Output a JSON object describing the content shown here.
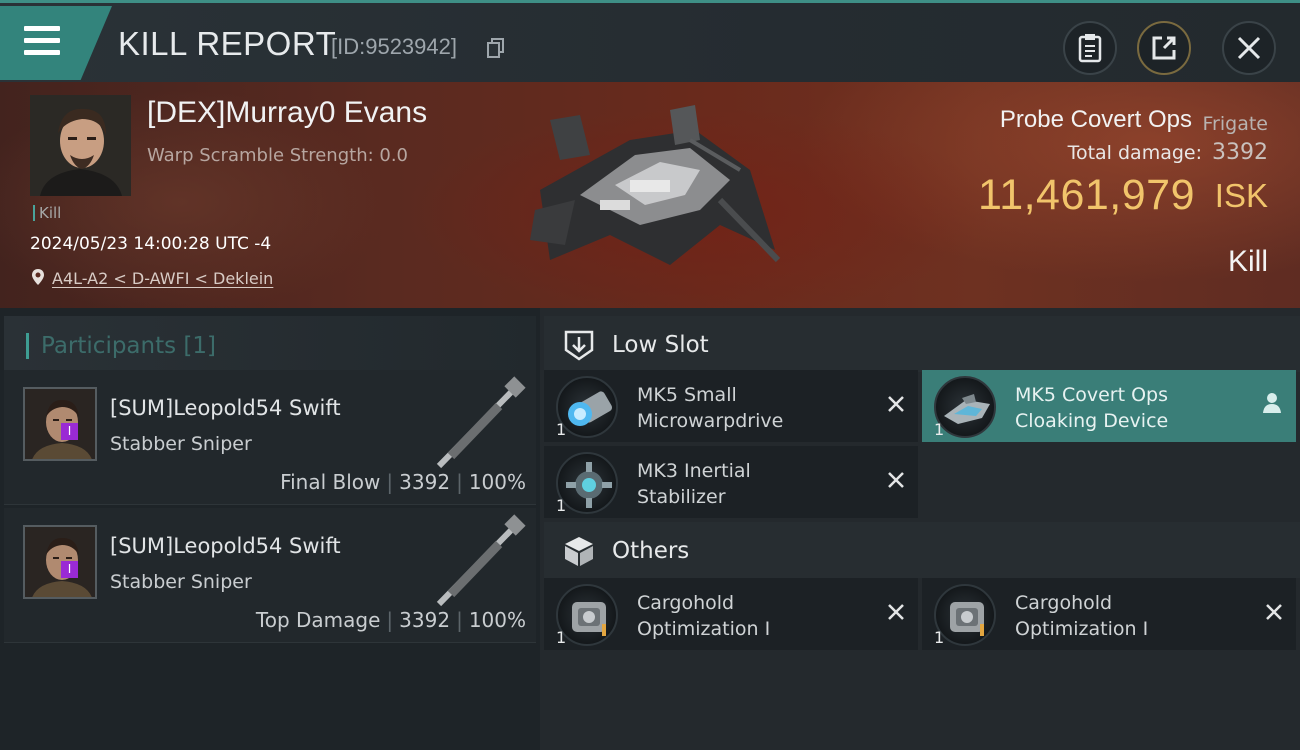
{
  "header": {
    "title": "KILL REPORT",
    "report_id": "[ID:9523942]",
    "menu_icon": "hamburger-menu-icon",
    "buttons": [
      {
        "name": "clipboard-icon"
      },
      {
        "name": "share-icon"
      },
      {
        "name": "close-icon"
      }
    ]
  },
  "victim": {
    "pilot_name": "[DEX]Murray0 Evans",
    "warp_scramble": "Warp Scramble Strength: 0.0",
    "kill_tag": "Kill",
    "datetime": "2024/05/23 14:00:28 UTC -4",
    "location": "A4L-A2 < D-AWFI < Deklein",
    "ship_name": "Probe Covert Ops",
    "ship_class": "Frigate",
    "total_damage_label": "Total damage:",
    "total_damage": "3392",
    "isk_value": "11,461,979",
    "isk_unit": "ISK",
    "result": "Kill"
  },
  "participants": {
    "title": "Participants [1]",
    "items": [
      {
        "name": "[SUM]Leopold54 Swift",
        "ship": "Stabber Sniper",
        "role": "Final Blow",
        "damage": "3392",
        "percent": "100%",
        "badge": "I"
      },
      {
        "name": "[SUM]Leopold54 Swift",
        "ship": "Stabber Sniper",
        "role": "Top Damage",
        "damage": "3392",
        "percent": "100%",
        "badge": "I"
      }
    ]
  },
  "fitting": {
    "low_slot": {
      "title": "Low Slot",
      "icon": "low-slot-icon",
      "modules": [
        {
          "qty": "1",
          "line1": "MK5 Small",
          "line2": "Microwarpdrive",
          "active": false
        },
        {
          "qty": "1",
          "line1": "MK5 Covert Ops",
          "line2": "Cloaking Device",
          "active": true
        },
        {
          "qty": "1",
          "line1": "MK3 Inertial",
          "line2": "Stabilizer",
          "active": false
        }
      ]
    },
    "others": {
      "title": "Others",
      "icon": "cargo-box-icon",
      "modules": [
        {
          "qty": "1",
          "line1": "Cargohold",
          "line2": "Optimization I",
          "active": false
        },
        {
          "qty": "1",
          "line1": "Cargohold",
          "line2": "Optimization I",
          "active": false
        }
      ]
    }
  },
  "colors": {
    "accent_teal": "#3e8f86",
    "isk_gold": "#f1c46b",
    "active_module": "#3a7e78",
    "badge_purple": "#9a2ad4"
  }
}
